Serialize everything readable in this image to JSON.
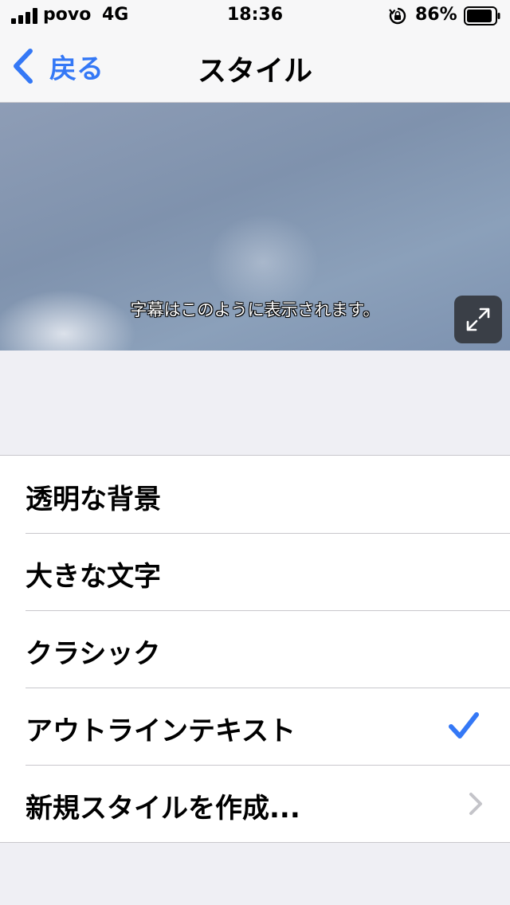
{
  "status_bar": {
    "carrier": "povo",
    "network": "4G",
    "time": "18:36",
    "battery_percent": "86%"
  },
  "nav": {
    "back_label": "戻る",
    "title": "スタイル"
  },
  "preview": {
    "caption": "字幕はこのように表示されます。"
  },
  "styles": [
    {
      "label": "透明な背景",
      "accessory": "none"
    },
    {
      "label": "大きな文字",
      "accessory": "none"
    },
    {
      "label": "クラシック",
      "accessory": "none"
    },
    {
      "label": "アウトラインテキスト",
      "accessory": "checkmark"
    },
    {
      "label": "新規スタイルを作成...",
      "accessory": "chevron"
    }
  ],
  "colors": {
    "accent": "#3478f6",
    "background": "#efeff4"
  }
}
